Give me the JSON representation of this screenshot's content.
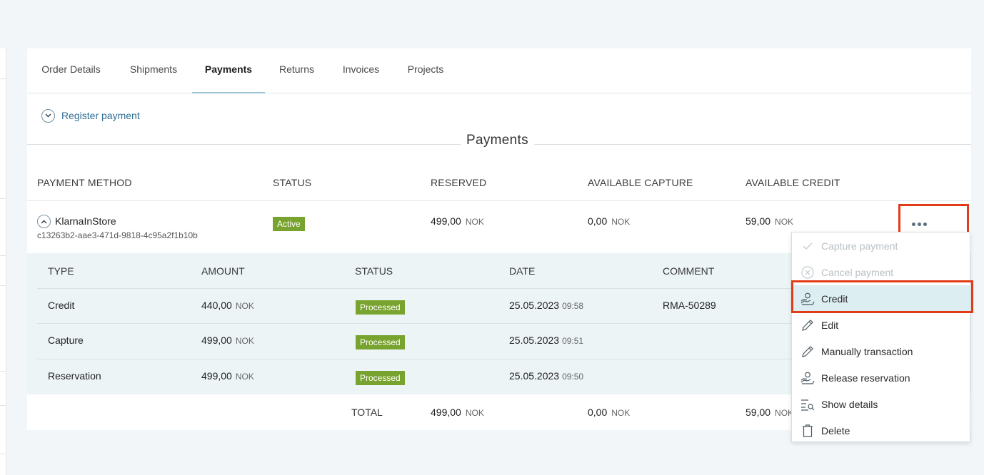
{
  "tabs": [
    {
      "label": "Order Details"
    },
    {
      "label": "Shipments"
    },
    {
      "label": "Payments",
      "active": true
    },
    {
      "label": "Returns"
    },
    {
      "label": "Invoices"
    },
    {
      "label": "Projects"
    }
  ],
  "register_payment": "Register payment",
  "section_title": "Payments",
  "columns": {
    "payment_method": "PAYMENT METHOD",
    "status": "STATUS",
    "reserved": "RESERVED",
    "available_capture": "AVAILABLE CAPTURE",
    "available_credit": "AVAILABLE CREDIT"
  },
  "payment": {
    "method": "KlarnaInStore",
    "id": "c13263b2-aae3-471d-9818-4c95a2f1b10b",
    "status": "Active",
    "reserved": "499,00",
    "available_capture": "0,00",
    "available_credit": "59,00",
    "currency": "NOK"
  },
  "sub_columns": {
    "type": "TYPE",
    "amount": "AMOUNT",
    "status": "STATUS",
    "date": "DATE",
    "comment": "COMMENT"
  },
  "transactions": [
    {
      "type": "Credit",
      "amount": "440,00",
      "currency": "NOK",
      "status": "Processed",
      "date": "25.05.2023",
      "time": "09:58",
      "comment": "RMA-50289"
    },
    {
      "type": "Capture",
      "amount": "499,00",
      "currency": "NOK",
      "status": "Processed",
      "date": "25.05.2023",
      "time": "09:51",
      "comment": ""
    },
    {
      "type": "Reservation",
      "amount": "499,00",
      "currency": "NOK",
      "status": "Processed",
      "date": "25.05.2023",
      "time": "09:50",
      "comment": ""
    }
  ],
  "totals": {
    "label": "TOTAL",
    "reserved": "499,00",
    "available_capture": "0,00",
    "available_credit": "59,00",
    "currency": "NOK"
  },
  "menu": [
    {
      "label": "Capture payment",
      "icon": "check-icon",
      "disabled": true
    },
    {
      "label": "Cancel payment",
      "icon": "cancel-circle-icon",
      "disabled": true
    },
    {
      "label": "Credit",
      "icon": "hand-coin-icon",
      "selected": true
    },
    {
      "label": "Edit",
      "icon": "pencil-icon"
    },
    {
      "label": "Manually transaction",
      "icon": "pencil-icon"
    },
    {
      "label": "Release reservation",
      "icon": "hand-coin-icon"
    },
    {
      "label": "Show details",
      "icon": "list-search-icon"
    },
    {
      "label": "Delete",
      "icon": "trash-icon"
    }
  ],
  "colors": {
    "accent_link": "#2f6e93",
    "status_green": "#78a32e",
    "highlight_red": "#e23c16",
    "subtable_bg": "#edf4f6",
    "menu_selected_bg": "#dceef2"
  }
}
